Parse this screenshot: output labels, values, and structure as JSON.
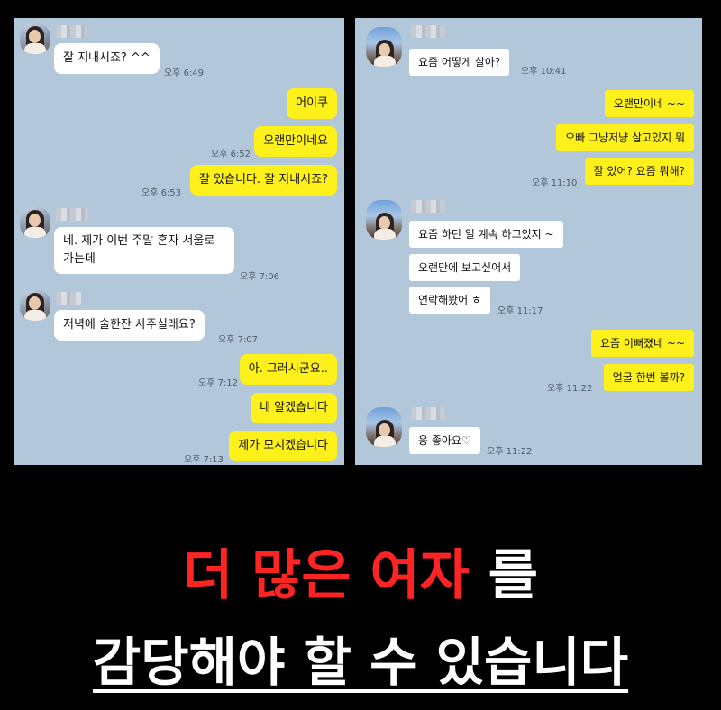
{
  "left_chat": {
    "messages": [
      {
        "text": "잘 지내시죠? ^^",
        "time": "오후 6:49"
      },
      {
        "text": "어이쿠"
      },
      {
        "text": "오랜만이네요",
        "time": "오후 6:52"
      },
      {
        "text": "잘 있습니다. 잘 지내시죠?",
        "time": "오후 6:53"
      },
      {
        "text_line1": "네. 제가 이번 주말 혼자 서울로",
        "text_line2": "가는데",
        "time": "오후 7:06"
      },
      {
        "text": "저녁에 술한잔 사주실래요?",
        "time": "오후 7:07"
      },
      {
        "text": "아. 그러시군요..",
        "time": "오후 7:12"
      },
      {
        "text": "네 알겠습니다"
      },
      {
        "text": "제가 모시겠습니다",
        "time": "오후 7:13"
      }
    ]
  },
  "right_chat": {
    "messages": [
      {
        "text": "요즘 어떻게 살아?",
        "time": "오후 10:41"
      },
      {
        "text": "오랜만이네 ~~"
      },
      {
        "text": "오빠 그냥저냥 살고있지 뭐"
      },
      {
        "text": "잘 있어? 요즘 뭐해?",
        "time": "오후 11:10"
      },
      {
        "text": "요즘 하던 일 계속 하고있지 ~"
      },
      {
        "text": "오랜만에 보고싶어서"
      },
      {
        "text": "연락해봤어 ㅎ",
        "time": "오후 11:17"
      },
      {
        "text": "요즘 이뻐졌네 ~~"
      },
      {
        "text": "얼굴 한번 볼까?",
        "time": "오후 11:22"
      },
      {
        "text": "응 좋아요♡",
        "time": "오후 11:22"
      }
    ]
  },
  "headline": {
    "line1_red": "더 많은 여자",
    "line1_white": "를",
    "line2": "감당해야 할 수 있습니다"
  },
  "colors": {
    "chat_background": "#b2c7da",
    "my_bubble": "#fef01b",
    "their_bubble": "#ffffff",
    "headline_red": "#ff2424"
  }
}
